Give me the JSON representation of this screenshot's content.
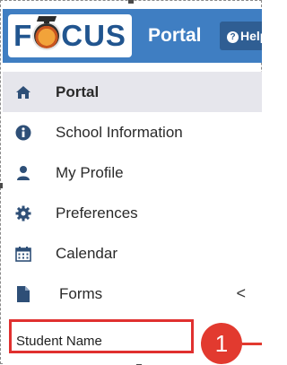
{
  "header": {
    "logo_text": "FOCUS",
    "portal_title": "Portal",
    "help_label": "Help"
  },
  "sidebar": {
    "items": [
      {
        "label": "Portal",
        "icon": "home-icon",
        "active": true
      },
      {
        "label": "School Information",
        "icon": "info-icon",
        "active": false
      },
      {
        "label": "My Profile",
        "icon": "user-icon",
        "active": false
      },
      {
        "label": "Preferences",
        "icon": "gear-icon",
        "active": false
      },
      {
        "label": "Calendar",
        "icon": "calendar-icon",
        "active": false
      },
      {
        "label": "Forms",
        "icon": "document-icon",
        "active": false,
        "chevron": "<"
      }
    ],
    "student_label": "Student Name"
  },
  "annotation": {
    "callout_number": "1"
  },
  "colors": {
    "header_bg": "#3f7ec2",
    "help_bg": "#2f5e93",
    "active_bg": "#e6e6ec",
    "highlight": "#e0302f",
    "callout": "#e23a2f",
    "icon": "#2e4f77"
  }
}
